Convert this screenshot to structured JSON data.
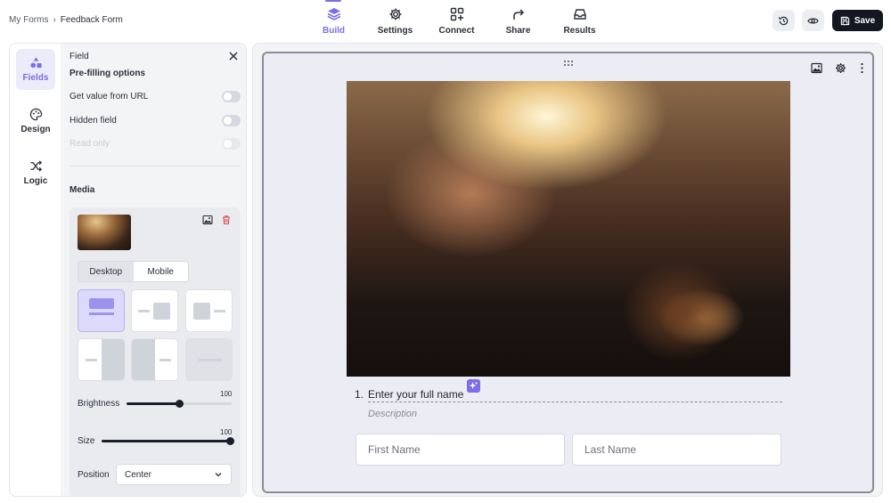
{
  "breadcrumb": {
    "root": "My Forms",
    "sep": "›",
    "current": "Feedback Form"
  },
  "nav": [
    {
      "label": "Build",
      "icon": "layers-icon",
      "active": true
    },
    {
      "label": "Settings",
      "icon": "gear-icon"
    },
    {
      "label": "Connect",
      "icon": "grid-plus-icon"
    },
    {
      "label": "Share",
      "icon": "share-arrow-icon"
    },
    {
      "label": "Results",
      "icon": "inbox-icon"
    }
  ],
  "toolbar": {
    "history_icon": "history-icon",
    "preview_icon": "eye-icon",
    "save_label": "Save"
  },
  "rail": [
    {
      "label": "Fields",
      "icon": "shapes-icon",
      "active": true
    },
    {
      "label": "Design",
      "icon": "palette-icon"
    },
    {
      "label": "Logic",
      "icon": "shuffle-icon"
    }
  ],
  "field_panel": {
    "title": "Field",
    "prefill_title": "Pre-filling options",
    "options": [
      {
        "label": "Get value from URL",
        "on": false,
        "disabled": false
      },
      {
        "label": "Hidden field",
        "on": false,
        "disabled": false
      },
      {
        "label": "Read only",
        "on": false,
        "disabled": true
      }
    ],
    "media_title": "Media",
    "device_tabs": {
      "desktop": "Desktop",
      "mobile": "Mobile",
      "selected": "Desktop"
    },
    "brightness": {
      "label": "Brightness",
      "value": "100",
      "fraction": 0.5
    },
    "size": {
      "label": "Size",
      "value": "100",
      "fraction": 1.0
    },
    "position": {
      "label": "Position",
      "value": "Center"
    }
  },
  "question": {
    "number": "1.",
    "text": "Enter your full name",
    "description": "Description",
    "first_placeholder": "First Name",
    "last_placeholder": "Last Name"
  },
  "colors": {
    "accent": "#7b6ee6",
    "dark": "#131722"
  }
}
